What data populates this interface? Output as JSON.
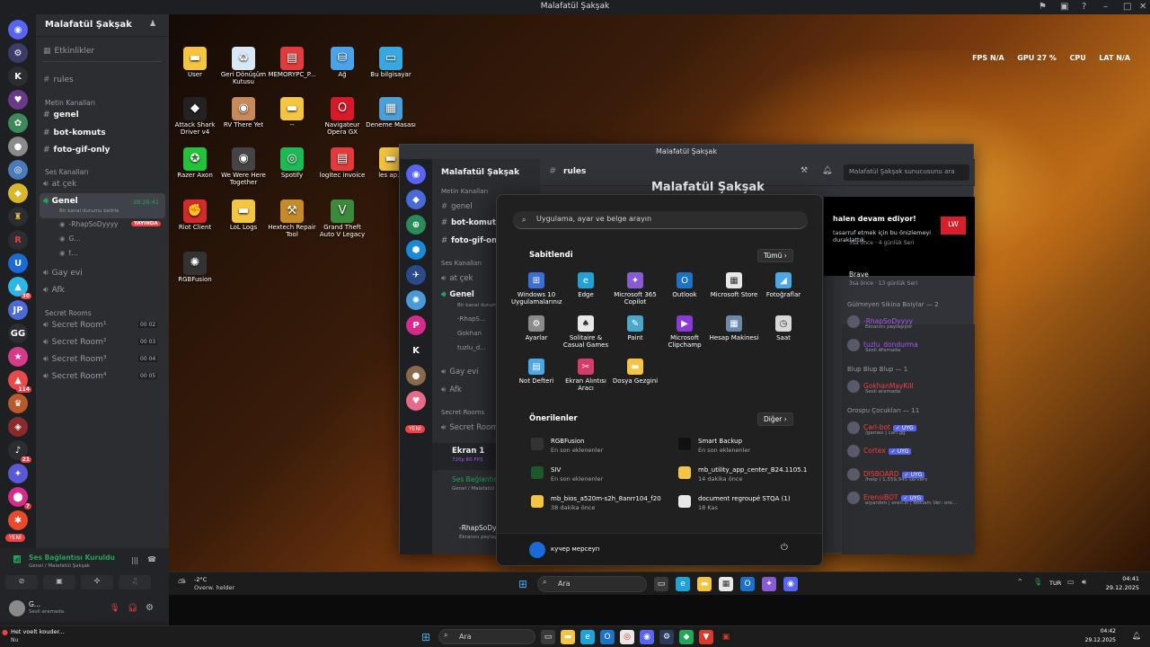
{
  "window": {
    "title": "Malafatül Şakşak"
  },
  "sidebar": {
    "server_name": "Malafatül Şakşak",
    "events": "Etkinlikler",
    "rules": "rules",
    "text_category": "Metin Kanalları",
    "text_channels": [
      "genel",
      "bot-komuts",
      "foto-gif-only"
    ],
    "voice_category": "Ses Kanalları",
    "voice_channels": [
      "at çek",
      "Genel",
      "Gay evi",
      "Afk"
    ],
    "genel_status": "Bir kanal durumu belirle",
    "genel_timer": "38:26:41",
    "voice_users": [
      "-RhapSoDyyyy",
      "G...",
      "t..."
    ],
    "live_badge": "YAYINDA",
    "secret_category": "Secret Rooms",
    "secret_rooms": [
      "Secret Room¹",
      "Secret Room²",
      "Secret Room³",
      "Secret Room⁴"
    ],
    "secret_counts": [
      "00 02",
      "00 03",
      "00 04",
      "00 05"
    ]
  },
  "voice_panel": {
    "title": "Ses Bağlantısı Kuruldu",
    "subtitle": "Genel / Malafatül Şakşak",
    "user": "G...",
    "user_status": "Sesli aramada"
  },
  "rail": {
    "new_badge": "YENİ"
  },
  "desktop": {
    "stats": {
      "fps": "FPS N/A",
      "gpu": "GPU 27 %",
      "cpu": "CPU",
      "lat": "LAT N/A"
    },
    "icons": [
      {
        "label": "User",
        "icon": "folder-icon",
        "color": "#f4c542"
      },
      {
        "label": "Geri Dönüşüm Kutusu",
        "icon": "recycle-bin-icon",
        "color": "#d9e8f5"
      },
      {
        "label": "MEMORYPC_P...",
        "icon": "pdf-icon",
        "color": "#e23b3b"
      },
      {
        "label": "Ağ",
        "icon": "network-icon",
        "color": "#4aa3e8"
      },
      {
        "label": "Bu bilgisayar",
        "icon": "computer-icon",
        "color": "#3aa8e0"
      },
      {
        "label": "Attack Shark Driver v4",
        "icon": "app-icon",
        "color": "#222222"
      },
      {
        "label": "RV There Yet",
        "icon": "game-icon",
        "color": "#c98a5a"
      },
      {
        "label": "--",
        "icon": "folder-icon",
        "color": "#f4c542"
      },
      {
        "label": "Navigateur Opera GX",
        "icon": "opera-icon",
        "color": "#d8192a"
      },
      {
        "label": "Deneme Masası",
        "icon": "control-panel-icon",
        "color": "#4a9fd8"
      },
      {
        "label": "Razer Axon",
        "icon": "razer-icon",
        "color": "#23c339"
      },
      {
        "label": "We Were Here Together",
        "icon": "game-icon",
        "color": "#444444"
      },
      {
        "label": "Spotify",
        "icon": "spotify-icon",
        "color": "#1db954"
      },
      {
        "label": "logitec invoice",
        "icon": "pdf-icon",
        "color": "#e23b3b"
      },
      {
        "label": "les ap...",
        "icon": "folder-icon",
        "color": "#f4c542"
      },
      {
        "label": "Riot Client",
        "icon": "riot-icon",
        "color": "#d22b2b"
      },
      {
        "label": "LoL Logs",
        "icon": "folder-icon",
        "color": "#f4c542"
      },
      {
        "label": "Hextech Repair Tool",
        "icon": "tool-icon",
        "color": "#c78a2a"
      },
      {
        "label": "Grand Theft Auto V Legacy",
        "icon": "gta-icon",
        "color": "#3a8a3a"
      },
      {
        "label": "RGBFusion",
        "icon": "rgb-icon",
        "color": "#333333"
      }
    ]
  },
  "inner_discord": {
    "title": "Malafatül Şakşak",
    "server_name": "Malafatül Şakşak",
    "channel": "rules",
    "search_placeholder": "Malafatül Şakşak sunucusunu ara",
    "heading": "Malafatül Şakşak",
    "text_category": "Metin Kanalları",
    "channels": [
      "genel",
      "bot-komuts",
      "foto-gif-onl"
    ],
    "voice_category": "Ses Kanalları",
    "voice": [
      "at çek",
      "Genel",
      "Gay evi",
      "Afk"
    ],
    "genel_status": "Bir kanal durumu belirle",
    "users": [
      "-RhapS...",
      "Gokhan",
      "tuzlu_d..."
    ],
    "secret_category": "Secret Rooms",
    "secret_room": "Secret Room",
    "screen": "Ekran 1",
    "screen_sub": "720p 60 FPS",
    "vc_title": "Ses Bağlantısı Kuru...",
    "vc_sub": "Genel / Malafatül Şakşak",
    "me": "-RhapSoDyyyy",
    "me_status": "Ekranını paylaşıyor",
    "new_badge": "YENİ",
    "promo_title": "halen devam ediyor!",
    "promo_body": "tasarruf etmek için bu önizlemeyi duraklattık.",
    "members": {
      "brave_name": "Brave",
      "brave_sub": "3sa önce · 13 günlük Seri",
      "top_sub": "3sa önce · 4 günlük Seri",
      "group1": "Gülmeyen Sikina Boiylar — 2",
      "g1": [
        {
          "name": "-RhapSoDyyyy",
          "sub": "Ekranını paylaşıyor",
          "color": "#a855f7"
        },
        {
          "name": "tuzlu_dondurma",
          "sub": "Sesli aramada",
          "color": "#a855f7"
        }
      ],
      "group2": "Blup Blup Blup — 1",
      "g2": [
        {
          "name": "GokhanMayKill",
          "sub": "Sesli aramada",
          "color": "#f23f43"
        }
      ],
      "group3": "Orospu Çocukları — 11",
      "g3": [
        {
          "name": "Carl-bot",
          "sub": "/games | carl.gg",
          "color": "#f23f43",
          "tag": "✓ UYG"
        },
        {
          "name": "Cortex",
          "sub": "",
          "color": "#f23f43",
          "tag": "✓ UYG"
        },
        {
          "name": "DISBOARD",
          "sub": "/help | 1,559,945 servers",
          "color": "#f23f43",
          "tag": "✓ UYG"
        },
        {
          "name": "ErensiBOT",
          "sub": "eiyardım | eren.si | Reklam Ver: ere...",
          "color": "#f23f43",
          "tag": "✓ UYG"
        }
      ]
    }
  },
  "start_menu": {
    "search_placeholder": "Uygulama, ayar ve belge arayın",
    "pinned_title": "Sabitlendi",
    "pinned_btn": "Tümü",
    "pinned": [
      {
        "label": "Windows 10 Uygulamalarınız",
        "icon": "windows-apps-icon",
        "color": "#3a6fd8"
      },
      {
        "label": "Edge",
        "icon": "edge-icon",
        "color": "#1fa3d6"
      },
      {
        "label": "Microsoft 365 Copilot",
        "icon": "copilot-icon",
        "color": "#8a5bd6"
      },
      {
        "label": "Outlook",
        "icon": "outlook-icon",
        "color": "#1a73c9"
      },
      {
        "label": "Microsoft Store",
        "icon": "store-icon",
        "color": "#e8e8e8"
      },
      {
        "label": "Fotoğraflar",
        "icon": "photos-icon",
        "color": "#4aa8e8"
      },
      {
        "label": "Ayarlar",
        "icon": "settings-icon",
        "color": "#8a8a8a"
      },
      {
        "label": "Solitaire & Casual Games",
        "icon": "cards-icon",
        "color": "#e8e8e8"
      },
      {
        "label": "Paint",
        "icon": "paint-icon",
        "color": "#4aa8c8"
      },
      {
        "label": "Microsoft Clipchamp",
        "icon": "clipchamp-icon",
        "color": "#8a3ad6"
      },
      {
        "label": "Hesap Makinesi",
        "icon": "calculator-icon",
        "color": "#6a8aa8"
      },
      {
        "label": "Saat",
        "icon": "clock-icon",
        "color": "#d8d8d8"
      },
      {
        "label": "Not Defteri",
        "icon": "notepad-icon",
        "color": "#4aa8e8"
      },
      {
        "label": "Ekran Alıntısı Aracı",
        "icon": "snipping-icon",
        "color": "#d83a6a"
      },
      {
        "label": "Dosya Gezgini",
        "icon": "folder-icon",
        "color": "#f4c542"
      }
    ],
    "recommended_title": "Önerilenler",
    "recommended_btn": "Diğer",
    "recommended": [
      {
        "name": "RGBFusion",
        "sub": "En son eklenenler",
        "color": "#333333"
      },
      {
        "name": "Smart Backup",
        "sub": "En son eklenenler",
        "color": "#111111"
      },
      {
        "name": "SIV",
        "sub": "En son eklenenler",
        "color": "#1a5a2a"
      },
      {
        "name": "mb_utility_app_center_B24.1105.1",
        "sub": "14 dakika önce",
        "color": "#f4c542"
      },
      {
        "name": "mb_bios_a520m-s2h_8anrr104_f20",
        "sub": "38 dakika önce",
        "color": "#f4c542"
      },
      {
        "name": "document regroupé STQA (1)",
        "sub": "18 Kas",
        "color": "#e8e8e8"
      }
    ],
    "user": "кучер мерсеуп"
  },
  "inner_taskbar": {
    "weather_temp": "-2°C",
    "weather_text": "Overw. helder",
    "search": "Ara",
    "lang": "TUR",
    "time": "04:41",
    "date": "29.12.2025"
  },
  "outer_taskbar": {
    "notif_title": "Het voelt kouder...",
    "notif_sub": "Nu",
    "search": "Ara",
    "time": "04:42",
    "date": "29.12.2025"
  }
}
